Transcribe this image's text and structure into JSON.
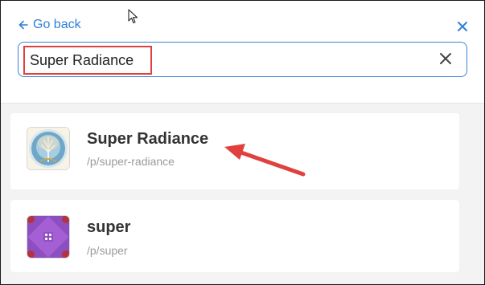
{
  "header": {
    "go_back_label": "Go back"
  },
  "search": {
    "value": "Super Radiance"
  },
  "results": [
    {
      "name": "Super Radiance",
      "path": "/p/super-radiance"
    },
    {
      "name": "super",
      "path": "/p/super"
    }
  ],
  "colors": {
    "accent": "#2f7fd8",
    "annotation": "#e0413e"
  },
  "icons": {
    "back": "arrow-left-icon",
    "close": "close-icon",
    "clear": "clear-search-icon"
  }
}
